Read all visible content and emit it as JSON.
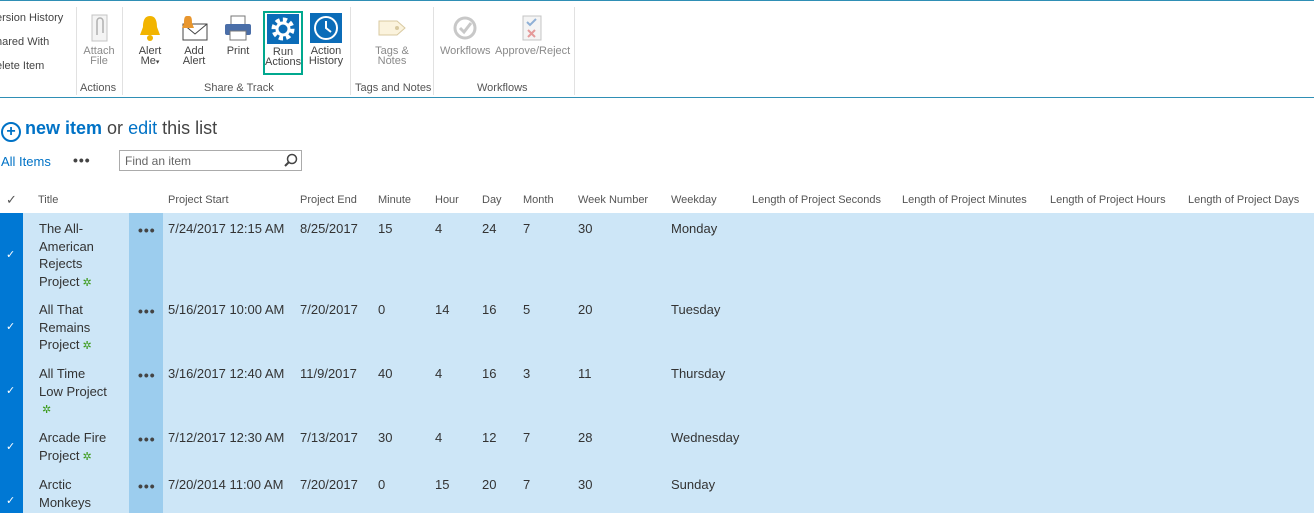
{
  "ribbon": {
    "left_items": [
      "ersion History",
      "hared With",
      "elete Item"
    ],
    "buttons": {
      "attach_file": [
        "Attach",
        "File"
      ],
      "alert_me": [
        "Alert",
        "Me"
      ],
      "add_alert": [
        "Add",
        "Alert"
      ],
      "print": "Print",
      "run_actions": [
        "Run",
        "Actions"
      ],
      "action_history": [
        "Action",
        "History"
      ],
      "tags_notes": [
        "Tags &",
        "Notes"
      ],
      "workflows": "Workflows",
      "approve_reject": "Approve/Reject"
    },
    "groups": {
      "actions": "Actions",
      "share_track": "Share & Track",
      "tags_and_notes": "Tags and Notes",
      "workflows": "Workflows"
    },
    "highlight_color": "#00a88e"
  },
  "list": {
    "new_item": "new item",
    "or": "or",
    "edit": "edit",
    "this_list": "this list",
    "view_all_items": "All Items",
    "search_placeholder": "Find an item"
  },
  "table": {
    "headers": {
      "title": "Title",
      "project_start": "Project Start",
      "project_end": "Project End",
      "minute": "Minute",
      "hour": "Hour",
      "day": "Day",
      "month": "Month",
      "week_number": "Week Number",
      "weekday": "Weekday",
      "len_seconds": "Length of Project Seconds",
      "len_minutes": "Length of Project Minutes",
      "len_hours": "Length of Project Hours",
      "len_days": "Length of Project Days"
    },
    "rows": [
      {
        "title_lines": [
          "The All-",
          "American",
          "Rejects",
          "Project"
        ],
        "start": "7/24/2017 12:15 AM",
        "end": "8/25/2017",
        "minute": "15",
        "hour": "4",
        "day": "24",
        "month": "7",
        "week": "30",
        "weekday": "Monday"
      },
      {
        "title_lines": [
          "All That",
          "Remains",
          "Project"
        ],
        "start": "5/16/2017 10:00 AM",
        "end": "7/20/2017",
        "minute": "0",
        "hour": "14",
        "day": "16",
        "month": "5",
        "week": "20",
        "weekday": "Tuesday"
      },
      {
        "title_lines": [
          "All Time",
          "Low Project",
          ""
        ],
        "start": "3/16/2017 12:40 AM",
        "end": "11/9/2017",
        "minute": "40",
        "hour": "4",
        "day": "16",
        "month": "3",
        "week": "11",
        "weekday": "Thursday"
      },
      {
        "title_lines": [
          "Arcade Fire",
          "Project"
        ],
        "start": "7/12/2017 12:30 AM",
        "end": "7/13/2017",
        "minute": "30",
        "hour": "4",
        "day": "12",
        "month": "7",
        "week": "28",
        "weekday": "Wednesday"
      },
      {
        "title_lines": [
          "Arctic",
          "Monkeys"
        ],
        "start": "7/20/2014 11:00 AM",
        "end": "7/20/2017",
        "minute": "0",
        "hour": "15",
        "day": "20",
        "month": "7",
        "week": "30",
        "weekday": "Sunday"
      }
    ]
  }
}
